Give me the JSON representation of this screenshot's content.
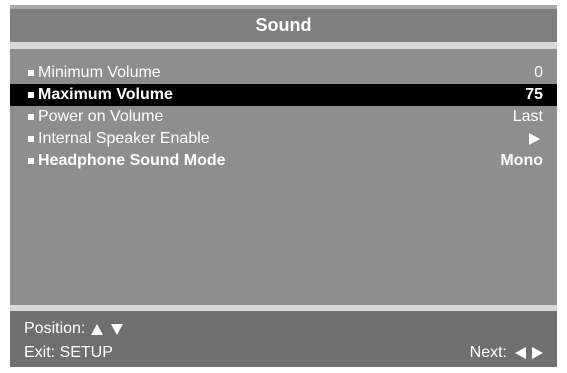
{
  "menu": {
    "title": "Sound",
    "items": [
      {
        "label": "Minimum Volume",
        "value": "0",
        "selected": false
      },
      {
        "label": "Maximum Volume",
        "value": "75",
        "selected": true
      },
      {
        "label": "Power on Volume",
        "value": "Last",
        "selected": false
      },
      {
        "label": "Internal Speaker Enable",
        "value": "",
        "value_icon": "right-triangle-icon",
        "selected": false
      },
      {
        "label": "Headphone Sound Mode",
        "value": "Mono",
        "selected": false
      }
    ]
  },
  "footer": {
    "position_label": "Position:",
    "exit_label": "Exit: SETUP",
    "next_label": "Next:"
  },
  "colors": {
    "panel": "#8e8e8e",
    "title_bar": "#7f7f7f",
    "separator": "#d9d9d9",
    "footer": "#6f6f6f",
    "selected_row": "#000000",
    "text": "#ffffff"
  }
}
